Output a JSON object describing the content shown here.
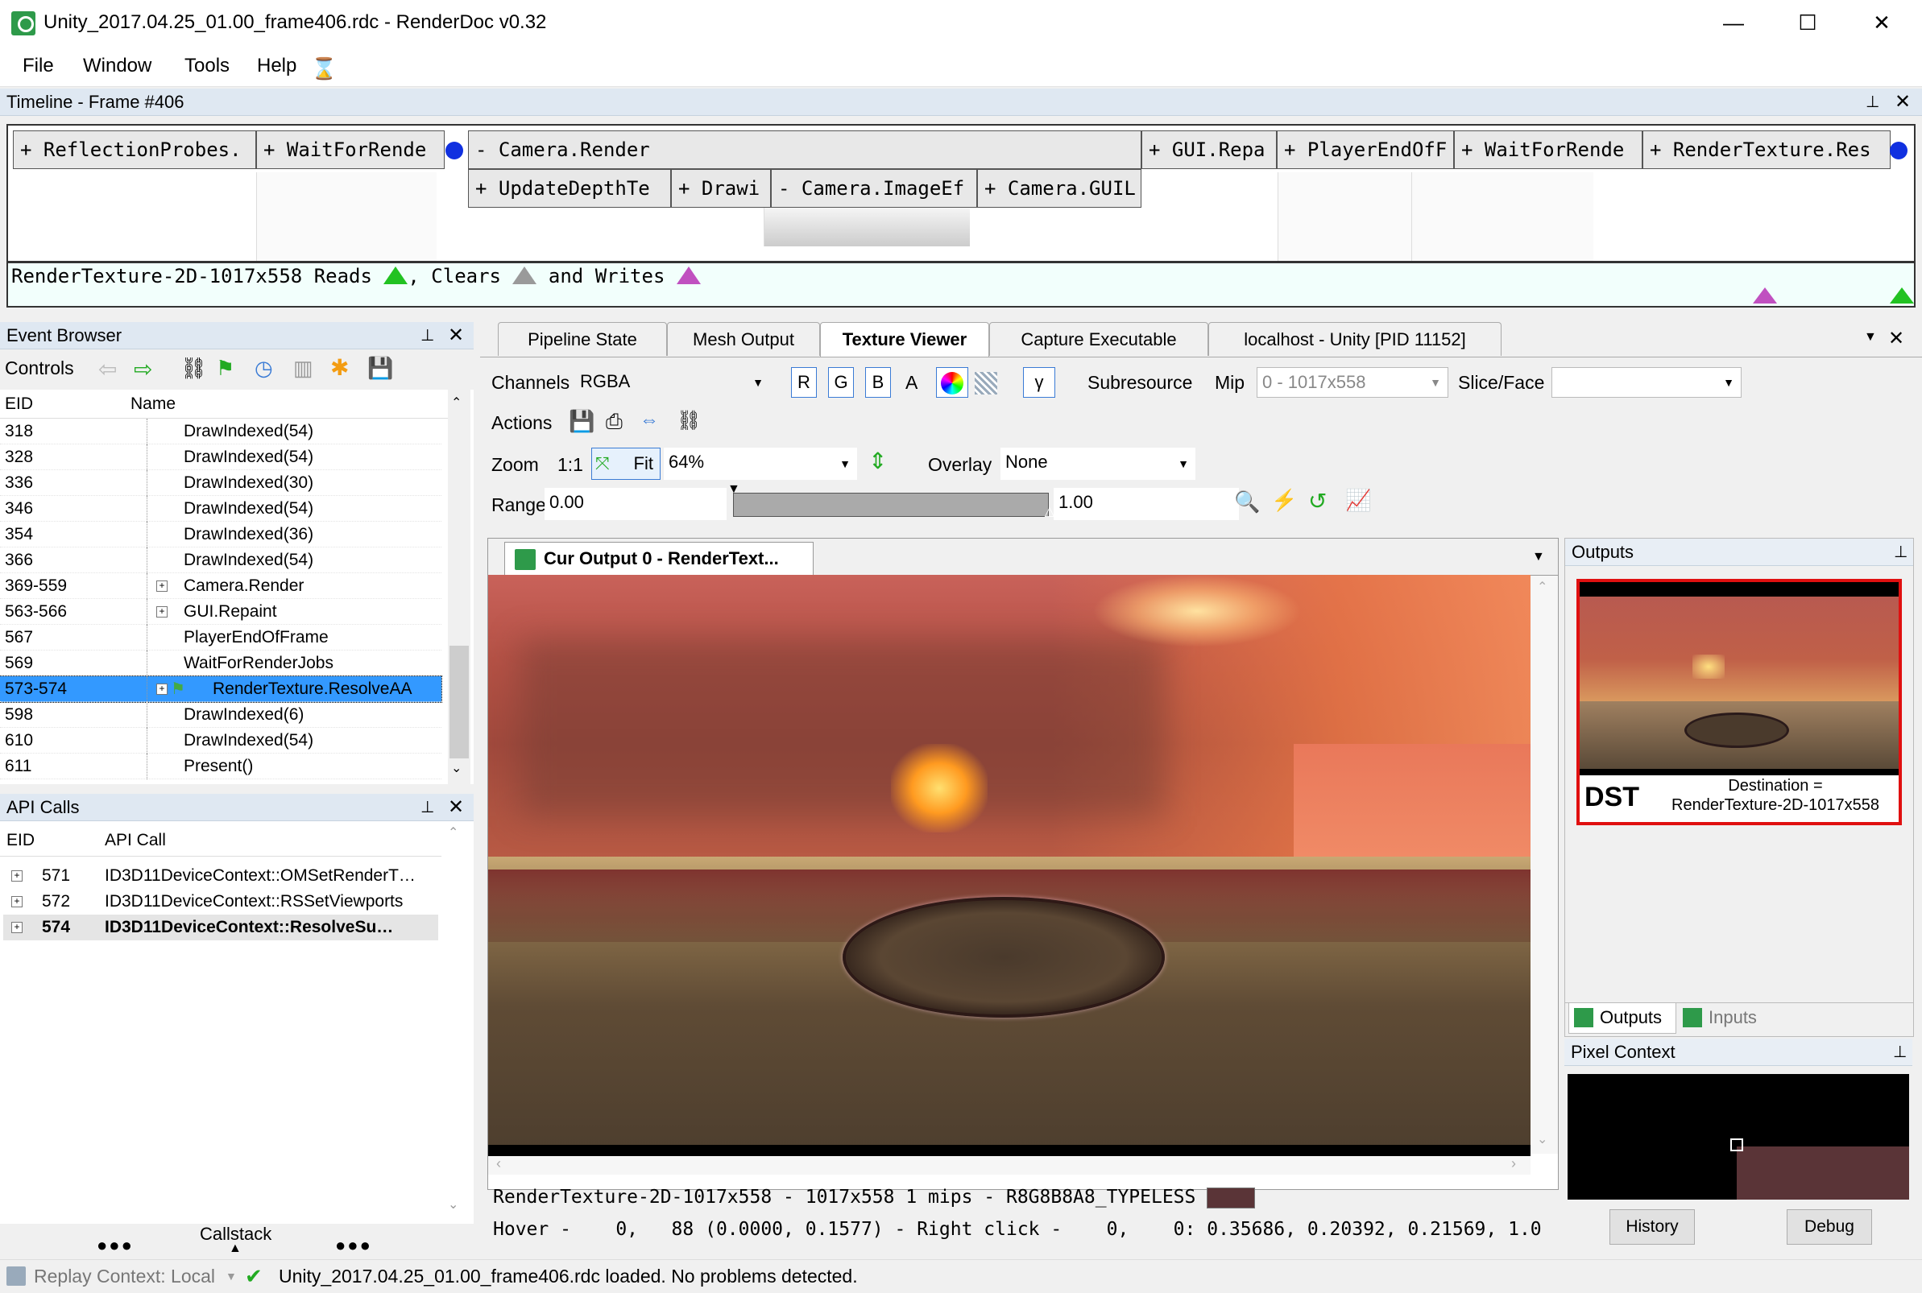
{
  "window": {
    "title": "Unity_2017.04.25_01.00_frame406.rdc - RenderDoc v0.32",
    "minimize": "—",
    "maximize": "☐",
    "close": "✕"
  },
  "menu": [
    "File",
    "Window",
    "Tools",
    "Help"
  ],
  "timeline": {
    "header": "Timeline - Frame #406",
    "top_blocks": [
      "+ ReflectionProbes.",
      "+ WaitForRende",
      "- Camera.Render",
      "+ GUI.Repa",
      "+ PlayerEndOfF",
      "+ WaitForRende",
      "+ RenderTexture.Res"
    ],
    "sub_blocks": [
      "+ UpdateDepthTe",
      "+ Drawi",
      "- Camera.ImageEf",
      "+ Camera.GUIL"
    ],
    "status": {
      "resource": "RenderTexture-2D-1017x558",
      "reads": "Reads",
      "comma": ",",
      "clears": "Clears",
      "and_writes": "and Writes"
    }
  },
  "event_browser": {
    "header": "Event Browser",
    "controls_label": "Controls",
    "col_eid": "EID",
    "col_name": "Name",
    "rows": [
      {
        "eid": "318",
        "name": "DrawIndexed(54)",
        "expand": false
      },
      {
        "eid": "328",
        "name": "DrawIndexed(54)",
        "expand": false
      },
      {
        "eid": "336",
        "name": "DrawIndexed(30)",
        "expand": false
      },
      {
        "eid": "346",
        "name": "DrawIndexed(54)",
        "expand": false
      },
      {
        "eid": "354",
        "name": "DrawIndexed(36)",
        "expand": false
      },
      {
        "eid": "366",
        "name": "DrawIndexed(54)",
        "expand": false
      },
      {
        "eid": "369-559",
        "name": "Camera.Render",
        "expand": true
      },
      {
        "eid": "563-566",
        "name": "GUI.Repaint",
        "expand": true
      },
      {
        "eid": "567",
        "name": "PlayerEndOfFrame",
        "expand": false
      },
      {
        "eid": "569",
        "name": "WaitForRenderJobs",
        "expand": false
      },
      {
        "eid": "573-574",
        "name": "RenderTexture.ResolveAA",
        "expand": true,
        "selected": true
      },
      {
        "eid": "598",
        "name": "DrawIndexed(6)",
        "expand": false
      },
      {
        "eid": "610",
        "name": "DrawIndexed(54)",
        "expand": false
      },
      {
        "eid": "611",
        "name": "Present()",
        "expand": false
      }
    ]
  },
  "api_calls": {
    "header": "API Calls",
    "col_eid": "EID",
    "col_call": "API Call",
    "rows": [
      {
        "eid": "571",
        "call": "ID3D11DeviceContext::OMSetRenderT…",
        "bold": false
      },
      {
        "eid": "572",
        "call": "ID3D11DeviceContext::RSSetViewports",
        "bold": false
      },
      {
        "eid": "574",
        "call": "ID3D11DeviceContext::ResolveSu…",
        "bold": true
      }
    ],
    "callstack": "Callstack"
  },
  "tabs": [
    "Pipeline State",
    "Mesh Output",
    "Texture Viewer",
    "Capture Executable",
    "localhost - Unity [PID 11152]"
  ],
  "texture_viewer": {
    "channels_label": "Channels",
    "channels_value": "RGBA",
    "channel_buttons": [
      "R",
      "G",
      "B",
      "A"
    ],
    "gamma": "γ",
    "subresource_label": "Subresource",
    "mip_label": "Mip",
    "mip_value": "0 - 1017x558",
    "slice_label": "Slice/Face",
    "slice_value": "",
    "actions_label": "Actions",
    "zoom_label": "Zoom",
    "zoom_1to1": "1:1",
    "fit_label": "Fit",
    "zoom_value": "64%",
    "overlay_label": "Overlay",
    "overlay_value": "None",
    "range_label": "Range",
    "range_min": "0.00",
    "range_max": "1.00",
    "output_tab": "Cur Output 0 - RenderText...",
    "info_line": "RenderTexture-2D-1017x558 - 1017x558 1 mips - R8G8B8A8_TYPELESS",
    "hover_line": "Hover -    0,   88 (0.0000, 0.1577) - Right click -    0,    0: 0.35686, 0.20392, 0.21569, 1.0",
    "swatch_color": "#5a3437"
  },
  "outputs": {
    "header": "Outputs",
    "dst": "DST",
    "destination_line1": "Destination =",
    "destination_line2": "RenderTexture-2D-1017x558",
    "tab_outputs": "Outputs",
    "tab_inputs": "Inputs"
  },
  "pixel_context": {
    "header": "Pixel Context",
    "history": "History",
    "debug": "Debug"
  },
  "statusbar": {
    "replay": "Replay Context: Local",
    "message": "Unity_2017.04.25_01.00_frame406.rdc loaded. No problems detected."
  },
  "colors": {
    "accent_blue": "#3399ff",
    "panel_header": "#dfe8f2",
    "read_green": "#22c222",
    "clear_gray": "#9a9a9a",
    "write_purple": "#c050c0",
    "output_border": "#e01010"
  }
}
